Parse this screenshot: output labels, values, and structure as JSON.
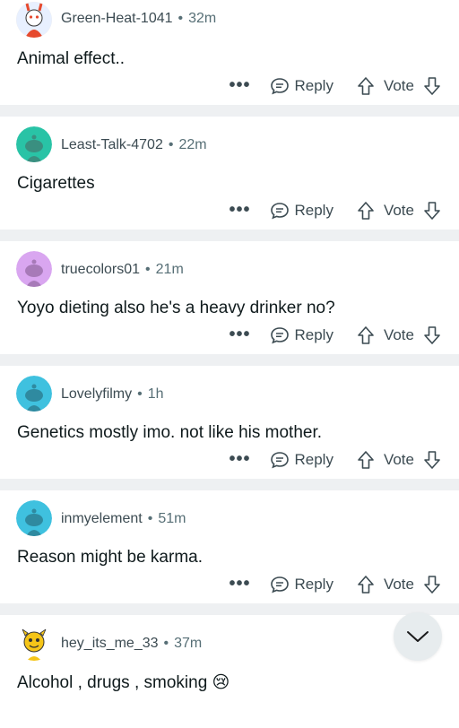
{
  "comments": [
    {
      "username": "Green-Heat-1041",
      "age": "32m",
      "text": "Animal effect..",
      "avatar_color": "#e64a2e"
    },
    {
      "username": "Least-Talk-4702",
      "age": "22m",
      "text": "Cigarettes",
      "avatar_color": "#29c3a6"
    },
    {
      "username": "truecolors01",
      "age": "21m",
      "text": "Yoyo dieting also he's a heavy drinker no?",
      "avatar_color": "#d9a6f0"
    },
    {
      "username": "Lovelyfilmy",
      "age": "1h",
      "text": "Genetics mostly imo. not like his mother.",
      "avatar_color": "#3fc1df"
    },
    {
      "username": "inmyelement",
      "age": "51m",
      "text": "Reason might be karma.",
      "avatar_color": "#3fc1df"
    },
    {
      "username": "hey_its_me_33",
      "age": "37m",
      "text": "Alcohol , drugs , smoking 😢",
      "avatar_color": "#f5c518"
    }
  ],
  "actions": {
    "more": "•••",
    "reply": "Reply",
    "vote": "Vote"
  },
  "separator": "•"
}
